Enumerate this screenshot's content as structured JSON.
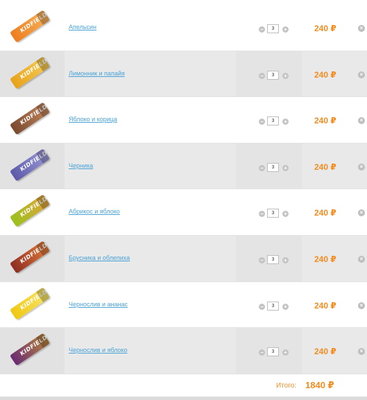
{
  "cart": {
    "items": [
      {
        "name": "Апельсин",
        "qty": "3",
        "price": "240 ₽",
        "color": "#ee7d1e",
        "accent": "#f6b15a",
        "minus": "−",
        "plus": "+",
        "remove": "×"
      },
      {
        "name": "Лимонник и папайя",
        "qty": "3",
        "price": "240 ₽",
        "color": "#e8a21b",
        "accent": "#f5cb55",
        "minus": "−",
        "plus": "+",
        "remove": "×"
      },
      {
        "name": "Яблоко и корица",
        "qty": "3",
        "price": "240 ₽",
        "color": "#7b4a2f",
        "accent": "#c0845d",
        "minus": "−",
        "plus": "+",
        "remove": "×"
      },
      {
        "name": "Черника",
        "qty": "3",
        "price": "240 ₽",
        "color": "#5c5aa8",
        "accent": "#9a97d6",
        "minus": "−",
        "plus": "+",
        "remove": "×"
      },
      {
        "name": "Абрикос и яблоко",
        "qty": "3",
        "price": "240 ₽",
        "color": "#9ac11f",
        "accent": "#e1a43a",
        "minus": "−",
        "plus": "+",
        "remove": "×"
      },
      {
        "name": "Брусника и облепиха",
        "qty": "3",
        "price": "240 ₽",
        "color": "#8e2d22",
        "accent": "#e07b3a",
        "minus": "−",
        "plus": "+",
        "remove": "×"
      },
      {
        "name": "Чернослив и ананас",
        "qty": "3",
        "price": "240 ₽",
        "color": "#f0c813",
        "accent": "#f7e46a",
        "minus": "−",
        "plus": "+",
        "remove": "×"
      },
      {
        "name": "Чернослив и яблоко",
        "qty": "3",
        "price": "240 ₽",
        "color": "#6a2b73",
        "accent": "#b7843c",
        "minus": "−",
        "plus": "+",
        "remove": "×"
      }
    ],
    "bar_logo": "KIDFIELD",
    "total_label": "Итого:",
    "total_value": "1840 ₽"
  },
  "colors": {
    "accent": "#f28c1f",
    "link": "#4aa3d6"
  }
}
